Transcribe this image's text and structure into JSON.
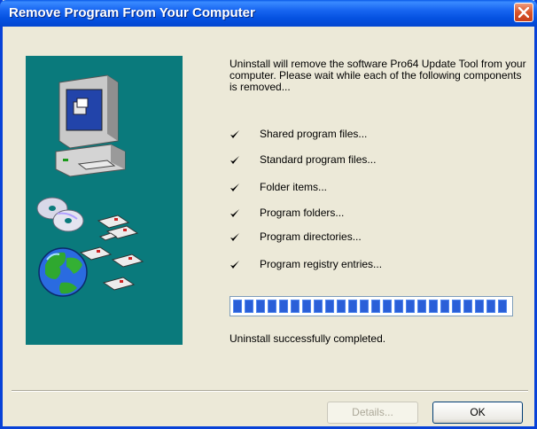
{
  "window": {
    "title": "Remove Program From Your Computer"
  },
  "description": "Uninstall will remove the software Pro64 Update Tool from your computer. Please wait while each of the following components is removed...",
  "components": [
    {
      "label": "Shared program files...",
      "checked": true
    },
    {
      "label": "Standard program files...",
      "checked": true
    },
    {
      "label": "Folder items...",
      "checked": true
    },
    {
      "label": "Program folders...",
      "checked": true
    },
    {
      "label": "Program directories...",
      "checked": true
    },
    {
      "label": "Program registry entries...",
      "checked": true
    }
  ],
  "progress": {
    "value": 1.0,
    "color": "#2a5fd8"
  },
  "status": "Uninstall successfully completed.",
  "buttons": {
    "details": "Details...",
    "ok": "OK"
  },
  "colors": {
    "titlebar": "#0451e0",
    "art_background": "#0a7a7c",
    "close": "#d9542a"
  },
  "icons": [
    "close-icon",
    "computer-icon",
    "cd-icon",
    "globe-icon",
    "floppy-disk-icon",
    "checkmark-icon"
  ]
}
